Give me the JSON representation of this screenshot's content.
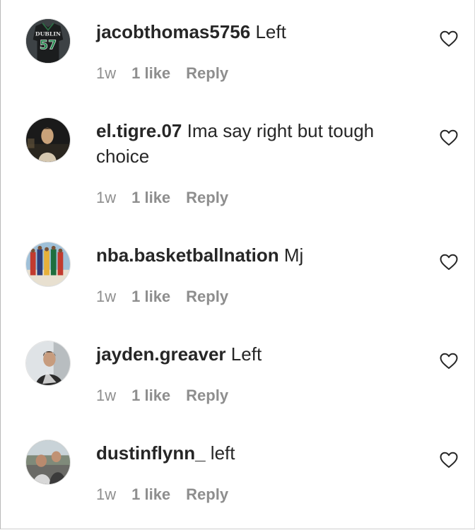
{
  "comments": [
    {
      "username": "jacobthomas5756",
      "text": "Left",
      "time": "1w",
      "likes": "1 like",
      "reply": "Reply",
      "avatar_icon": "jersey-avatar",
      "avatar_jersey_text": "DUBLIN",
      "avatar_jersey_number": "57"
    },
    {
      "username": "el.tigre.07",
      "text": "Ima say right but tough choice",
      "time": "1w",
      "likes": "1 like",
      "reply": "Reply",
      "avatar_icon": "person-photo-avatar"
    },
    {
      "username": "nba.basketballnation",
      "text": "Mj",
      "time": "1w",
      "likes": "1 like",
      "reply": "Reply",
      "avatar_icon": "team-photo-avatar"
    },
    {
      "username": "jayden.greaver",
      "text": "Left",
      "time": "1w",
      "likes": "1 like",
      "reply": "Reply",
      "avatar_icon": "person-photo-avatar"
    },
    {
      "username": "dustinflynn_",
      "text": "left",
      "time": "1w",
      "likes": "1 like",
      "reply": "Reply",
      "avatar_icon": "person-photo-avatar"
    }
  ],
  "colors": {
    "text_primary": "#262626",
    "text_secondary": "#8e8e8e",
    "background": "#ffffff"
  }
}
